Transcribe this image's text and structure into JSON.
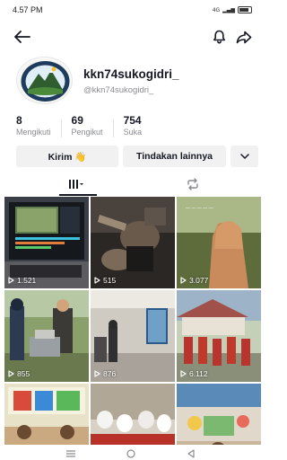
{
  "status_bar": {
    "time": "4.57 PM",
    "network": "4G",
    "signal": "il",
    "battery_icon": "battery-icon"
  },
  "profile": {
    "username": "kkn74sukogidri_",
    "handle": "@kkn74sukogidri_"
  },
  "stats": {
    "following": {
      "value": "8",
      "label": "Mengikuti"
    },
    "followers": {
      "value": "69",
      "label": "Pengikut"
    },
    "likes": {
      "value": "754",
      "label": "Suka"
    }
  },
  "actions": {
    "message_label": "Kirim 👋",
    "more_actions_label": "Tindakan lainnya"
  },
  "tabs": [
    {
      "name": "videos",
      "icon": "grid-icon",
      "active": true
    },
    {
      "name": "reposts",
      "icon": "repost-icon",
      "active": false
    }
  ],
  "videos": [
    {
      "views": "1.521",
      "scene": "laptop-video-editing"
    },
    {
      "views": "515",
      "scene": "hands-crafting"
    },
    {
      "views": "3.077",
      "scene": "girl-hijab-field"
    },
    {
      "views": "855",
      "scene": "outdoor-group-cart"
    },
    {
      "views": "876",
      "scene": "indoor-room"
    },
    {
      "views": "6.112",
      "scene": "students-red-uniform"
    },
    {
      "views": "",
      "scene": "classroom-kids"
    },
    {
      "views": "",
      "scene": "students-hijab-red"
    },
    {
      "views": "",
      "scene": "classroom-decoration"
    }
  ],
  "colors": {
    "text": "#161823",
    "muted": "#8a8b91",
    "button_bg": "#f1f1f2"
  }
}
